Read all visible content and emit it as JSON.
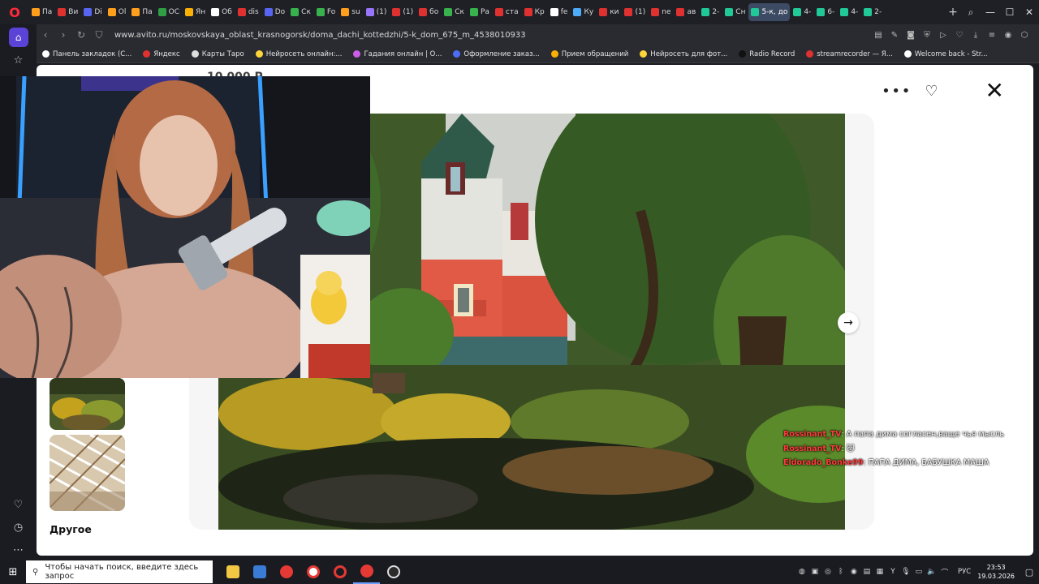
{
  "browser": {
    "tabs": [
      {
        "label": "Па",
        "color": "#ff9f1c"
      },
      {
        "label": "Ви",
        "color": "#e03131"
      },
      {
        "label": "Di",
        "color": "#5865f2"
      },
      {
        "label": "Ol",
        "color": "#ff9f1c"
      },
      {
        "label": "Па",
        "color": "#ff9f1c"
      },
      {
        "label": "ОС",
        "color": "#2f9e44"
      },
      {
        "label": "Ян",
        "color": "#fab005"
      },
      {
        "label": "Об",
        "color": "#ffffff"
      },
      {
        "label": "dis",
        "color": "#e03131"
      },
      {
        "label": "Do",
        "color": "#5865f2"
      },
      {
        "label": "Ск",
        "color": "#37b24d"
      },
      {
        "label": "Fo",
        "color": "#37b24d"
      },
      {
        "label": "su",
        "color": "#ff9f1c"
      },
      {
        "label": "(1)",
        "color": "#9775fa"
      },
      {
        "label": "(1)",
        "color": "#e03131"
      },
      {
        "label": "бо",
        "color": "#e03131"
      },
      {
        "label": "Ск",
        "color": "#37b24d"
      },
      {
        "label": "Ра",
        "color": "#37b24d"
      },
      {
        "label": "ста",
        "color": "#e03131"
      },
      {
        "label": "Кр",
        "color": "#e03131"
      },
      {
        "label": "fe",
        "color": "#ffffff"
      },
      {
        "label": "Ку",
        "color": "#4dabf7"
      },
      {
        "label": "ки",
        "color": "#e03131"
      },
      {
        "label": "(1)",
        "color": "#e03131"
      },
      {
        "label": "ne",
        "color": "#e03131"
      },
      {
        "label": "ав",
        "color": "#e03131"
      },
      {
        "label": "2-",
        "color": "#20c997"
      },
      {
        "label": "Сн",
        "color": "#20c997"
      },
      {
        "label": "5-к, до",
        "color": "#20c997",
        "active": true
      },
      {
        "label": "4-",
        "color": "#20c997"
      },
      {
        "label": "6-",
        "color": "#20c997"
      },
      {
        "label": "4-",
        "color": "#20c997"
      },
      {
        "label": "2-",
        "color": "#20c997"
      }
    ],
    "url": "www.avito.ru/moskovskaya_oblast_krasnogorsk/doma_dachi_kottedzhi/5-k_dom_675_m_4538010933",
    "bookmarks": [
      {
        "label": "Панель закладок (С...",
        "color": "#ffffff"
      },
      {
        "label": "Яндекс",
        "color": "#e03131"
      },
      {
        "label": "Карты Таро",
        "color": "#dddddd"
      },
      {
        "label": "Нейросеть онлайн:...",
        "color": "#ffd43b"
      },
      {
        "label": "Гадания онлайн | О...",
        "color": "#cc5de8"
      },
      {
        "label": "Оформление заказ...",
        "color": "#4c6ef5"
      },
      {
        "label": "Прием обращений",
        "color": "#fab005"
      },
      {
        "label": "Нейросеть для фот...",
        "color": "#ffd43b"
      },
      {
        "label": "Radio Record",
        "color": "#111111"
      },
      {
        "label": "streamrecorder — Я...",
        "color": "#e03131"
      },
      {
        "label": "Welcome back - Str...",
        "color": "#ffffff"
      }
    ]
  },
  "listing": {
    "other_label": "Другое",
    "price_peek": "10 000 Р"
  },
  "chat": [
    {
      "user": "Rossinant_TV",
      "text": ": А папа дима согласен,ваще чья мысль"
    },
    {
      "user": "Rossinant_TV",
      "text": ": 🐱"
    },
    {
      "user": "Eldorado_Bonke99",
      "text": ": ПАПА ДИМА, БАБУШКА МАША"
    }
  ],
  "taskbar": {
    "search_placeholder": "Чтобы начать поиск, введите здесь запрос",
    "language": "РУС",
    "time": "23:53",
    "date": "19.03.2026"
  }
}
